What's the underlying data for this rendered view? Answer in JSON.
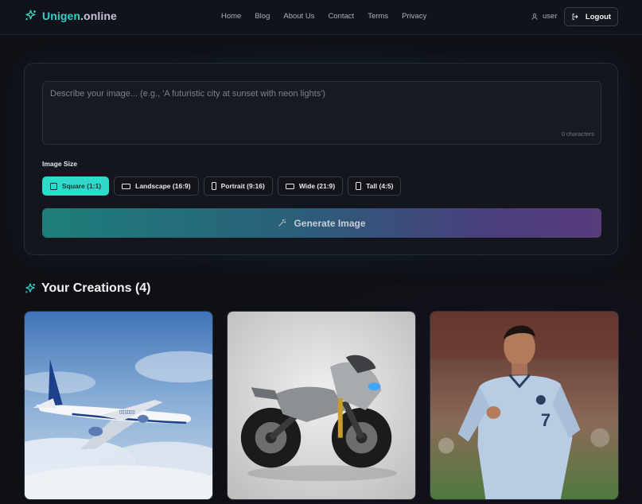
{
  "brand": {
    "name_part1": "Unigen",
    "name_part2": ".online",
    "icon": "sparkles-icon",
    "accent": "#2cd3c6"
  },
  "nav": {
    "items": [
      {
        "label": "Home"
      },
      {
        "label": "Blog"
      },
      {
        "label": "About Us"
      },
      {
        "label": "Contact"
      },
      {
        "label": "Terms"
      },
      {
        "label": "Privacy"
      }
    ]
  },
  "user": {
    "name": "user",
    "icon": "user-icon"
  },
  "logout": {
    "label": "Logout",
    "icon": "logout-icon"
  },
  "prompt": {
    "placeholder": "Describe your image... (e.g., 'A futuristic city at sunset with neon lights')",
    "value": "",
    "char_count": "0 characters"
  },
  "image_size": {
    "label": "Image Size",
    "options": [
      {
        "label": "Square (1:1)",
        "selected": true
      },
      {
        "label": "Landscape (16:9)",
        "selected": false
      },
      {
        "label": "Portrait (9:16)",
        "selected": false
      },
      {
        "label": "Wide (21:9)",
        "selected": false
      },
      {
        "label": "Tall (4:5)",
        "selected": false
      }
    ]
  },
  "generate": {
    "label": "Generate Image",
    "icon": "magic-wand-icon",
    "gradient": [
      "#1d7f7a",
      "#583c7c"
    ]
  },
  "creations": {
    "title": "Your Creations (4)",
    "icon": "sparkles-icon",
    "items": [
      {
        "subject": "airplane"
      },
      {
        "subject": "motorcycle"
      },
      {
        "subject": "soccer-player"
      }
    ]
  }
}
